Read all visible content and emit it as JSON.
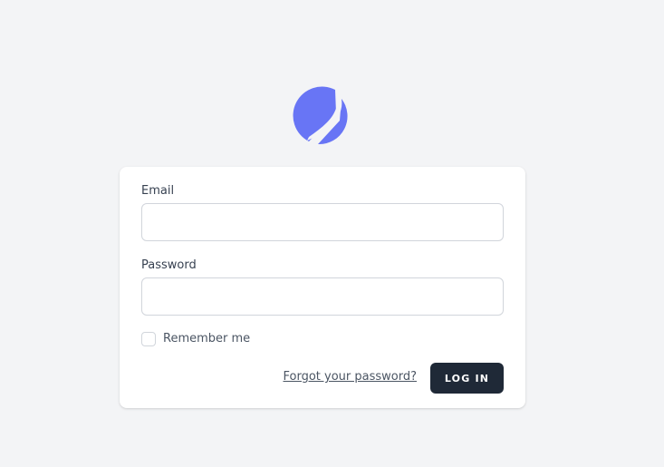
{
  "brand": {
    "logo_icon": "planet-logo-icon",
    "accent_color": "#6875f5"
  },
  "form": {
    "email_label": "Email",
    "email_value": "",
    "password_label": "Password",
    "password_value": "",
    "remember_label": "Remember me",
    "remember_checked": false,
    "forgot_link": "Forgot your password?",
    "login_button": "LOG IN",
    "button_color": "#1f2937"
  }
}
